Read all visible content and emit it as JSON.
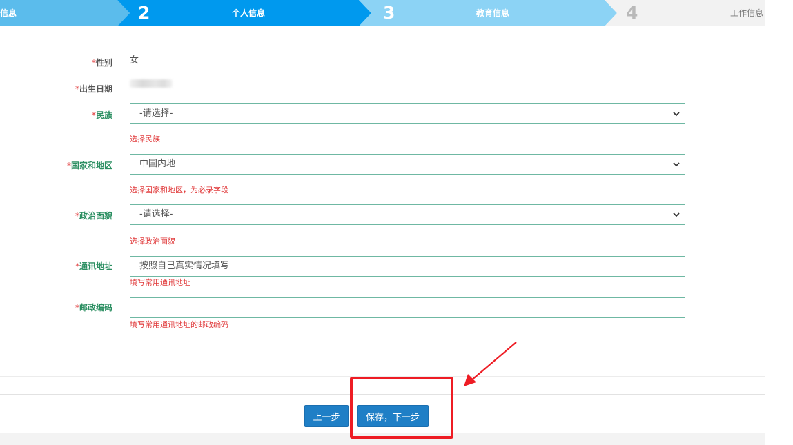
{
  "steps": [
    {
      "number": "",
      "label": "信息"
    },
    {
      "number": "2",
      "label": "个人信息"
    },
    {
      "number": "3",
      "label": "教育信息"
    },
    {
      "number": "4",
      "label": "工作信息"
    }
  ],
  "form": {
    "required_mark": "*",
    "gender": {
      "label": "性别",
      "value": "女"
    },
    "birthdate": {
      "label": "出生日期"
    },
    "ethnicity": {
      "label": "民族",
      "value": "-请选择-",
      "hint": "选择民族"
    },
    "country_region": {
      "label": "国家和地区",
      "value": "中国内地",
      "hint": "选择国家和地区，为必录字段"
    },
    "political_status": {
      "label": "政治面貌",
      "value": "-请选择-",
      "hint": "选择政治面貌"
    },
    "address": {
      "label": "通讯地址",
      "value": "按照自己真实情况填写",
      "hint": "填写常用通讯地址"
    },
    "postal_code": {
      "label": "邮政编码",
      "value": "",
      "hint": "填写常用通讯地址的邮政编码"
    }
  },
  "buttons": {
    "prev": "上一步",
    "save_next": "保存，下一步"
  },
  "colors": {
    "step_active": "#0099ee",
    "step_pending": "#8cd3f5",
    "step_inactive": "#f2f2f2",
    "button": "#1f7fc6",
    "error_text": "#e0393a",
    "label_green": "#2c8f62",
    "annotation_red": "#ee1c24"
  }
}
